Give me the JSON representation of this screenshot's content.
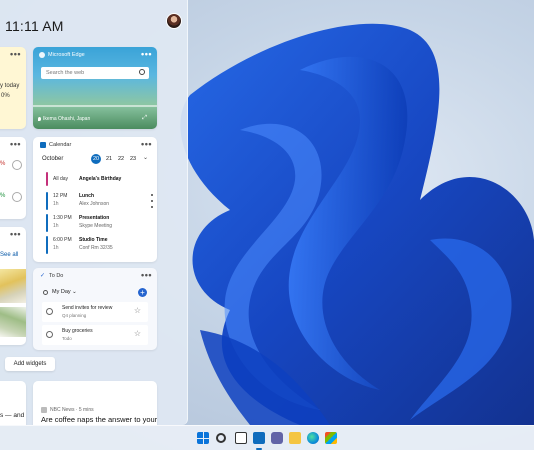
{
  "panel": {
    "time": "11:11 AM",
    "add_widgets_label": "Add widgets"
  },
  "weather": {
    "line1": "y today",
    "line2": "0%"
  },
  "stocks": {
    "change1": "%",
    "change2": "%"
  },
  "photos": {
    "see_all": "See all"
  },
  "edge_widget": {
    "title": "Microsoft Edge",
    "search_placeholder": "Search the web",
    "location": "Ikema Ohashi, Japan"
  },
  "calendar": {
    "title": "Calendar",
    "month": "October",
    "days": [
      "20",
      "21",
      "22",
      "23"
    ],
    "selected_day": "20",
    "events": [
      {
        "when": "All day",
        "when2": "",
        "what": "Angela's Birthday",
        "who": "",
        "color": "#c4307a"
      },
      {
        "when": "12 PM",
        "when2": "1h",
        "what": "Lunch",
        "who": "Alex  Johnson",
        "color": "#0f6cbd"
      },
      {
        "when": "1:30 PM",
        "when2": "1h",
        "what": "Presentation",
        "who": "Skype Meeting",
        "color": "#0f6cbd"
      },
      {
        "when": "6:00 PM",
        "when2": "1h",
        "what": "Studio Time",
        "who": "Conf Rm 32/35",
        "color": "#0f6cbd"
      }
    ]
  },
  "todo": {
    "title": "To Do",
    "list_name": "My Day",
    "tasks": [
      {
        "name": "Send invites for review",
        "sub": "Q4 planning"
      },
      {
        "name": "Buy groceries",
        "sub": "Todo"
      }
    ]
  },
  "news": {
    "left_text": "s — and",
    "source": "NBC News · 5 mins",
    "headline": "Are coffee naps the answer to your"
  },
  "colors": {
    "accent": "#0f6cbd",
    "panel_bg": "#e0e8f3"
  }
}
